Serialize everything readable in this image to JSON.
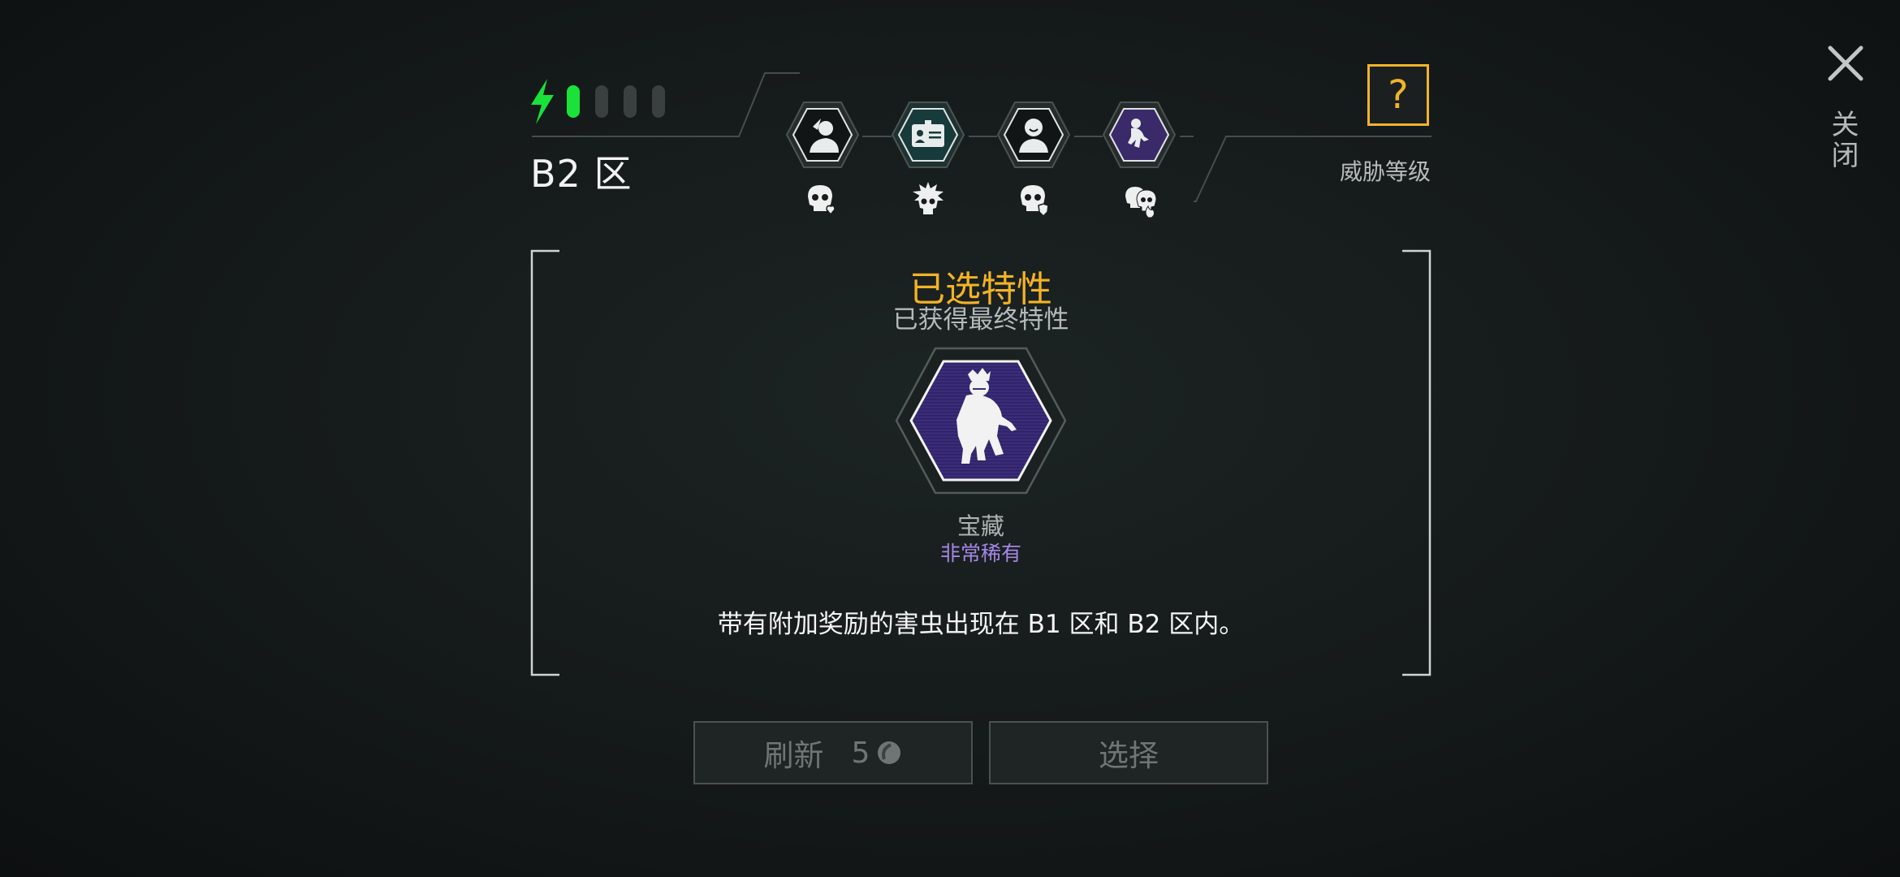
{
  "header": {
    "zone_title": "B2 区",
    "threat_label": "威胁等级",
    "help_label": "?",
    "close_label": "关闭",
    "energy": {
      "filled": 1,
      "total": 4
    }
  },
  "threat_icons": [
    {
      "icon": "person-bird-icon",
      "sub_icon": "skull-heart-icon"
    },
    {
      "icon": "id-card-icon",
      "sub_icon": "skull-burst-icon"
    },
    {
      "icon": "smiling-person-icon",
      "sub_icon": "skull-shield-icon"
    },
    {
      "icon": "crouching-creature-icon",
      "sub_icon": "skulls-fire-icon"
    }
  ],
  "selection": {
    "title": "已选特性",
    "subtitle": "已获得最终特性",
    "trait_icon": "crouching-creature-icon",
    "trait_name": "宝藏",
    "trait_rarity": "非常稀有",
    "description": "带有附加奖励的害虫出现在 B1 区和 B2 区内。"
  },
  "buttons": {
    "refresh_label": "刷新",
    "refresh_cost": "5",
    "select_label": "选择"
  },
  "colors": {
    "accent_gold": "#f3b324",
    "energy_green": "#19e23a",
    "rarity_purple": "#a487e6"
  }
}
